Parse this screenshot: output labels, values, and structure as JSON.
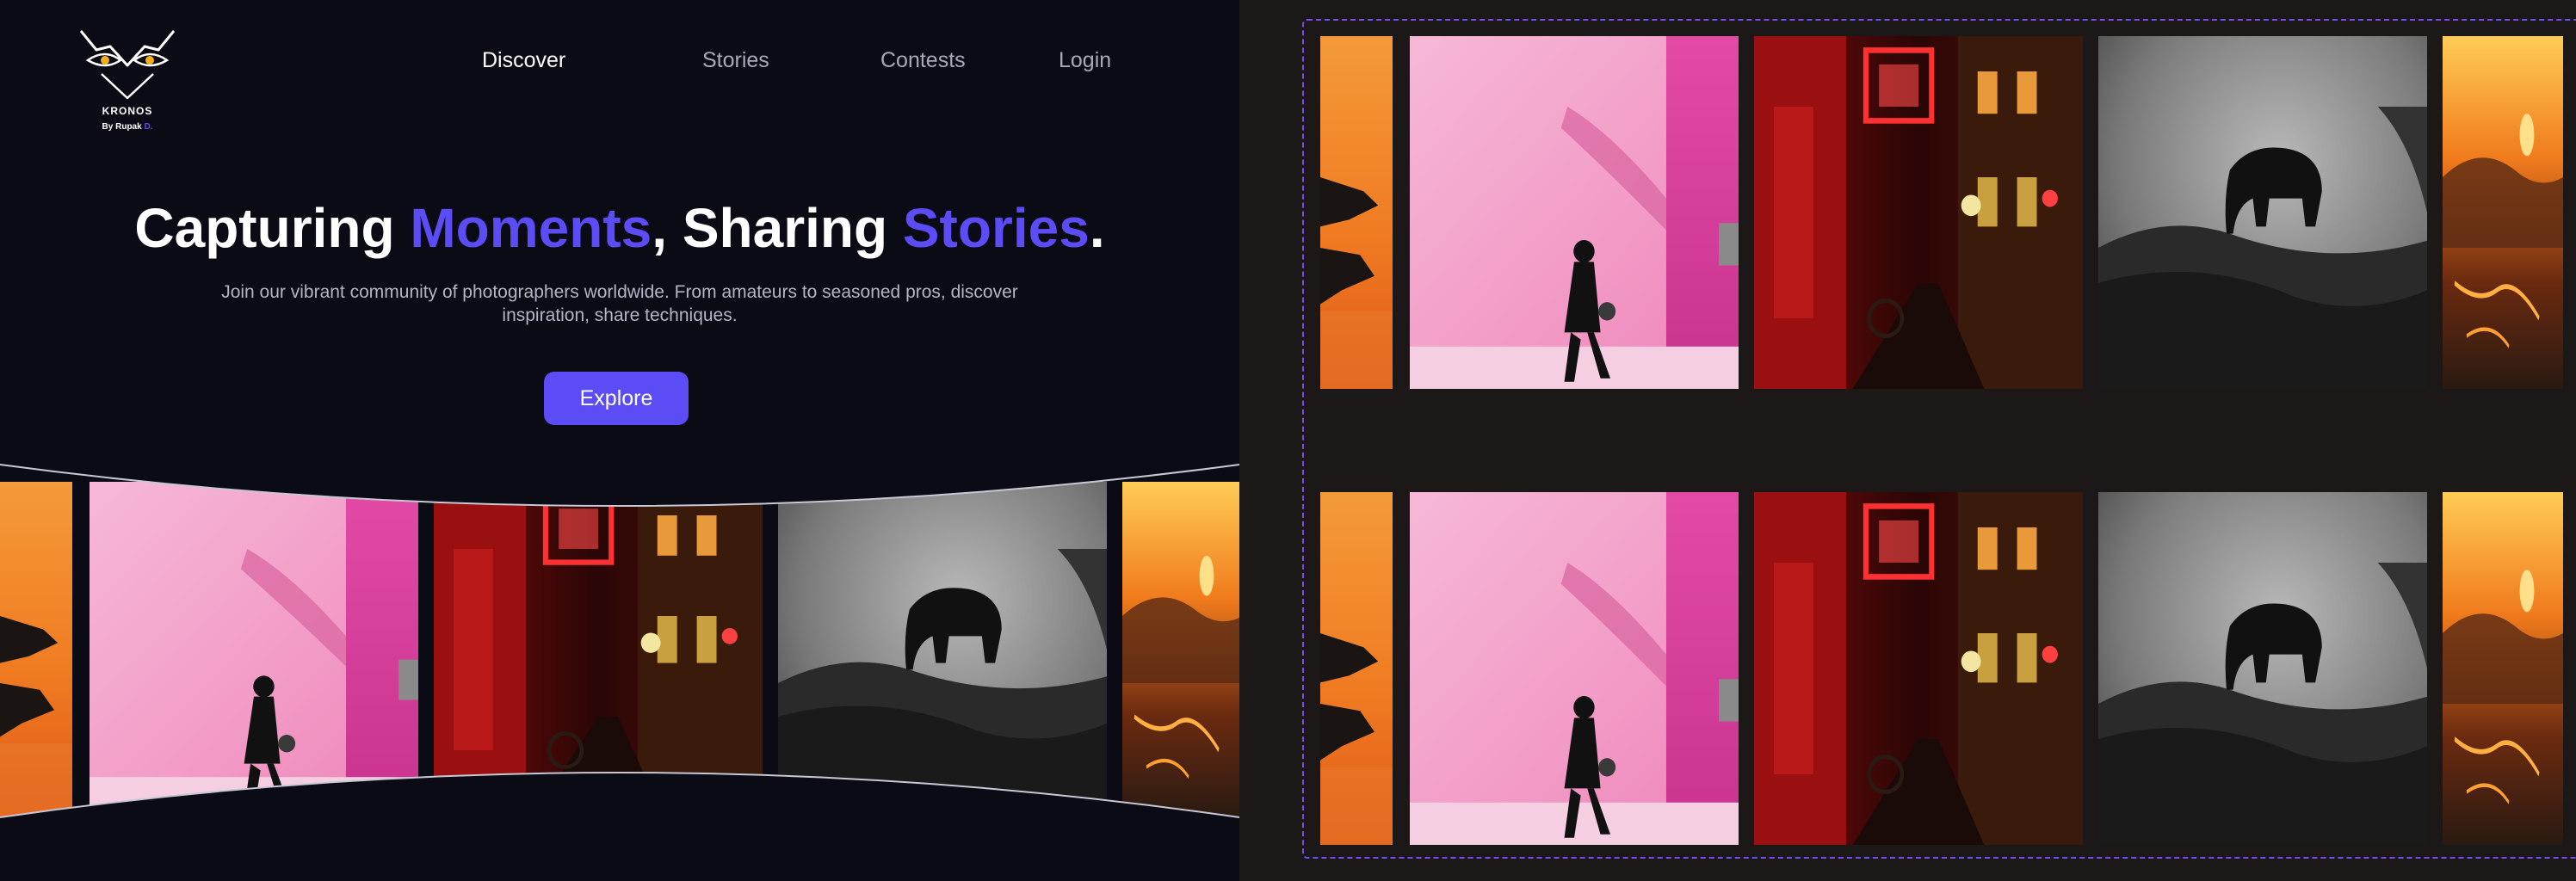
{
  "brand": {
    "name": "KRONOS",
    "by_prefix": "By Rupak",
    "by_accent": "D.",
    "logo_icon": "owl-face-icon"
  },
  "nav": {
    "items": [
      {
        "label": "Discover",
        "active": true
      },
      {
        "label": "Stories",
        "active": false
      },
      {
        "label": "Contests",
        "active": false
      },
      {
        "label": "Login",
        "active": false
      }
    ]
  },
  "hero": {
    "headline_part1": "Capturing ",
    "headline_highlight1": "Moments",
    "headline_part2": ", Sharing ",
    "headline_highlight2": "Stories",
    "headline_part3": ".",
    "subtext": "Join our vibrant community of photographers worldwide. From amateurs to seasoned pros, discover inspiration, share techniques.",
    "cta_label": "Explore"
  },
  "gallery": {
    "photos": [
      {
        "name": "sunset-rocks-photo",
        "subject": "sunset cliffs"
      },
      {
        "name": "pink-wall-woman-photo",
        "subject": "woman walking past pink wall"
      },
      {
        "name": "neon-street-photo",
        "subject": "red neon alley at night"
      },
      {
        "name": "elephant-fog-photo",
        "subject": "elephant in fog, black and white"
      },
      {
        "name": "mountain-sunset-photo",
        "subject": "fiery sunset over valley"
      }
    ]
  },
  "colors": {
    "accent": "#5b4cf5",
    "background_left": "#0b0b16",
    "background_right": "#1c1818",
    "frame_outline": "#7a4cf0"
  }
}
